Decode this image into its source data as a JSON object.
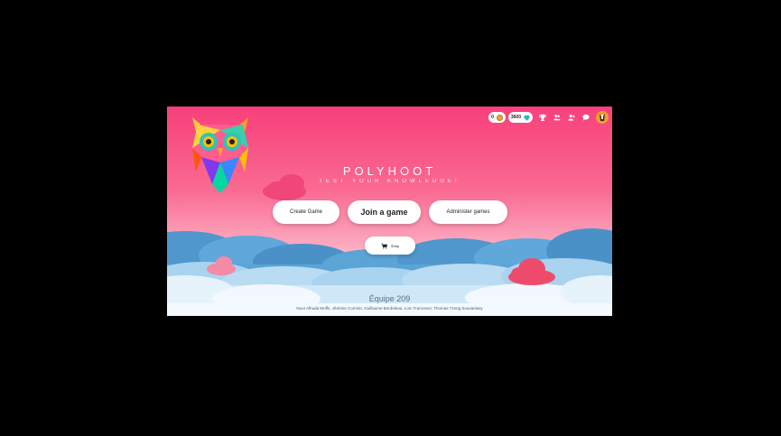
{
  "app": {
    "title": "POLYHOOT",
    "subtitle": "TEST YOUR KNOWLEDGE!"
  },
  "header": {
    "coins": "0",
    "gems": "3600",
    "icons": [
      "trophy-icon",
      "friends-icon",
      "add-friend-icon",
      "chat-icon",
      "avatar"
    ]
  },
  "actions": {
    "create": "Create Game",
    "join": "Join a game",
    "admin": "Administer games",
    "shop": "Shop"
  },
  "footer": {
    "team": "Équipe 209",
    "members": "Nour Alhuda Moffs, Jérémie Cormier, Guillaume Bordeleau, Loïc Francoeur, Thomas Tzeng Souvanlasy"
  },
  "colors": {
    "accent_pink": "#f7407a",
    "cloud_blue": "#5aa4d6",
    "cloud_light": "#cfe8f7",
    "cloud_coral": "#ef5070"
  }
}
